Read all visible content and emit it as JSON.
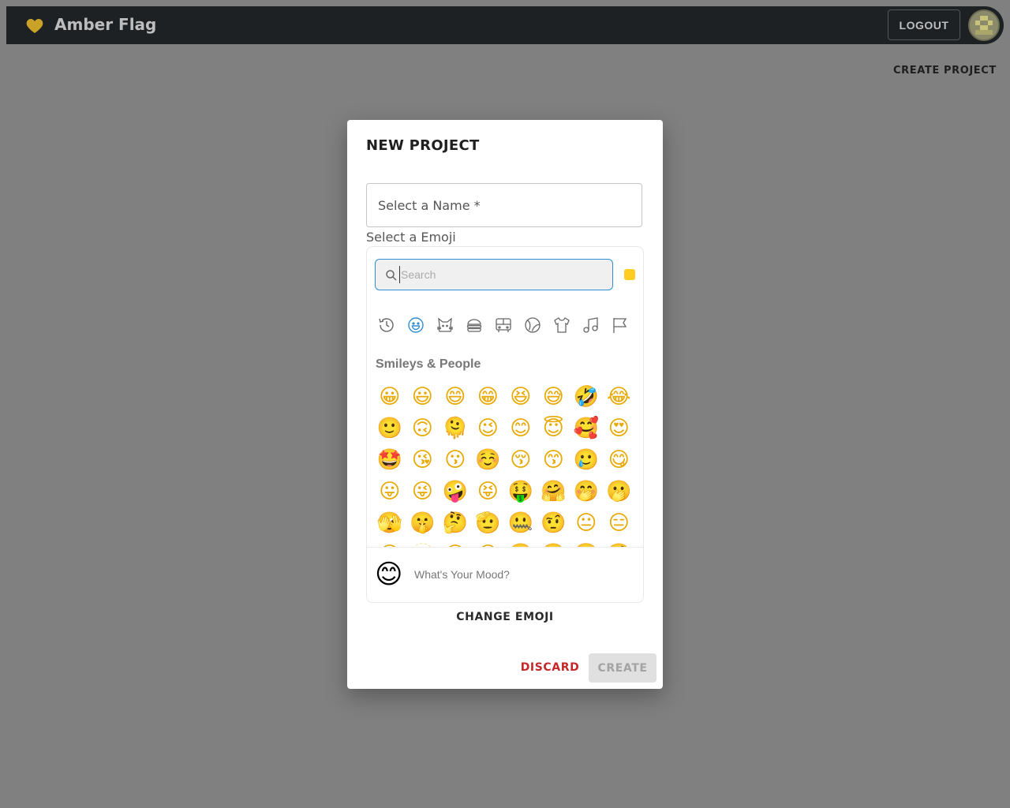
{
  "app": {
    "title": "Amber Flag",
    "brand_color": "#c9a227"
  },
  "header": {
    "logout_label": "LOGOUT"
  },
  "page": {
    "create_project_label": "CREATE PROJECT"
  },
  "modal": {
    "title": "NEW PROJECT",
    "name_field": {
      "label": "Select a Name *",
      "value": ""
    },
    "emoji_label": "Select a Emoji",
    "picker": {
      "search_placeholder": "Search",
      "skin_tone_color": "#ffcc22",
      "categories": [
        {
          "icon": "clock-icon",
          "name": "recent",
          "active": false
        },
        {
          "icon": "smiley-icon",
          "name": "smileys",
          "active": true
        },
        {
          "icon": "cat-icon",
          "name": "animals",
          "active": false
        },
        {
          "icon": "burger-icon",
          "name": "food",
          "active": false
        },
        {
          "icon": "bus-icon",
          "name": "travel",
          "active": false
        },
        {
          "icon": "ball-icon",
          "name": "activities",
          "active": false
        },
        {
          "icon": "shirt-icon",
          "name": "objects",
          "active": false
        },
        {
          "icon": "music-icon",
          "name": "symbols",
          "active": false
        },
        {
          "icon": "flag-icon",
          "name": "flags",
          "active": false
        }
      ],
      "active_color": "#2f8fd1",
      "section_title": "Smileys & People",
      "emojis": [
        "😀",
        "😃",
        "😄",
        "😁",
        "😆",
        "😅",
        "🤣",
        "😂",
        "🙂",
        "🙃",
        "🫠",
        "😉",
        "😊",
        "😇",
        "🥰",
        "😍",
        "🤩",
        "😘",
        "😗",
        "☺️",
        "😚",
        "😙",
        "🥲",
        "😋",
        "😛",
        "😜",
        "🤪",
        "😝",
        "🤑",
        "🤗",
        "🤭",
        "🫢",
        "🫣",
        "🤫",
        "🤔",
        "🫡",
        "🤐",
        "🤨",
        "😐",
        "😑",
        "😶",
        "🫥",
        "😏",
        "😒",
        "🙄",
        "😬",
        "😮‍💨",
        "🤥"
      ],
      "preview_emoji": "😊",
      "preview_text": "What's Your Mood?"
    },
    "change_emoji_label": "CHANGE EMOJI",
    "discard_label": "DISCARD",
    "create_label": "CREATE"
  }
}
